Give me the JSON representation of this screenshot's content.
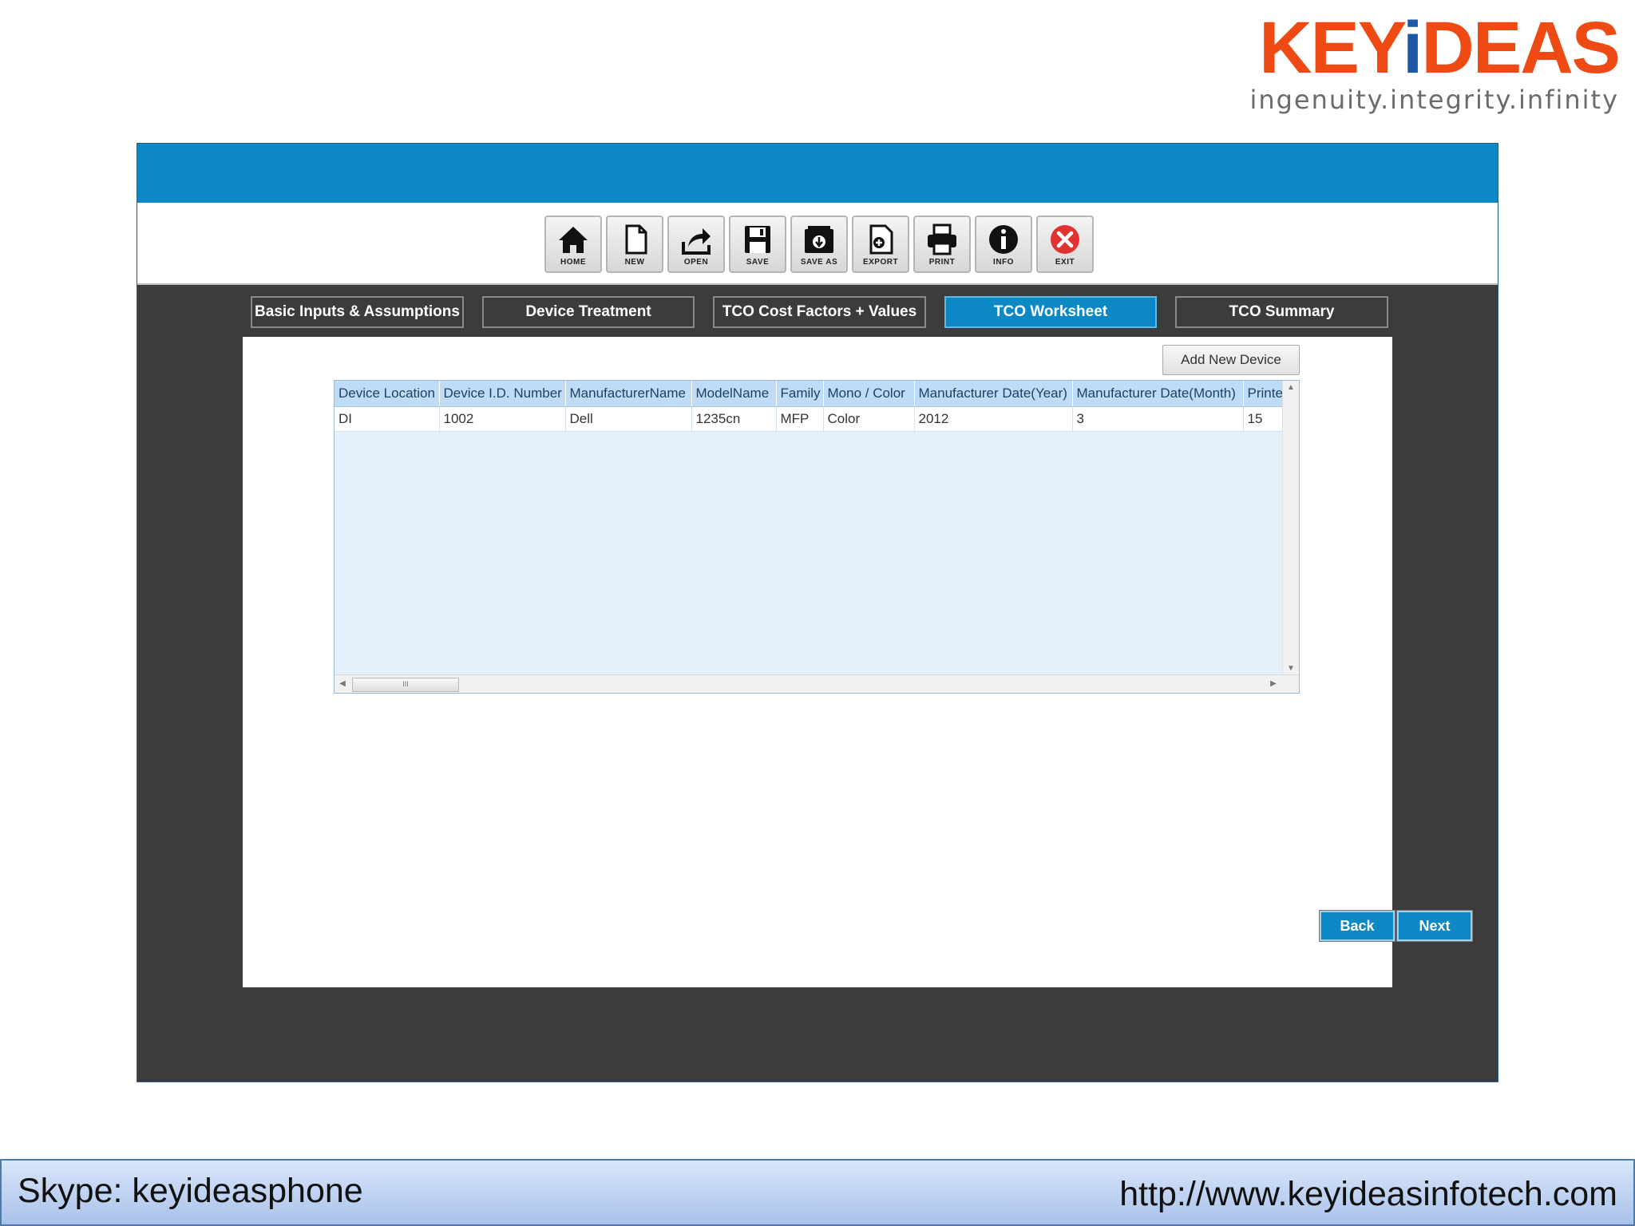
{
  "logo": {
    "word_part1": "KEY",
    "word_i": "i",
    "word_part2": "DEAS",
    "tagline": "ingenuity.integrity.infinity",
    "colors": {
      "word": "#f04a14",
      "i": "#1d58a8",
      "tagline": "#6b6b6b"
    }
  },
  "toolbar": {
    "buttons": [
      {
        "label": "HOME",
        "icon": "home-icon"
      },
      {
        "label": "NEW",
        "icon": "new-document-icon"
      },
      {
        "label": "OPEN",
        "icon": "open-share-icon"
      },
      {
        "label": "SAVE",
        "icon": "save-icon"
      },
      {
        "label": "SAVE AS",
        "icon": "save-as-icon"
      },
      {
        "label": "EXPORT",
        "icon": "export-icon"
      },
      {
        "label": "PRINT",
        "icon": "print-icon"
      },
      {
        "label": "INFO",
        "icon": "info-icon"
      },
      {
        "label": "EXIT",
        "icon": "exit-icon"
      }
    ]
  },
  "tabs": [
    {
      "label": "Basic Inputs & Assumptions",
      "active": false
    },
    {
      "label": "Device Treatment",
      "active": false
    },
    {
      "label": "TCO Cost Factors + Values",
      "active": false
    },
    {
      "label": "TCO Worksheet",
      "active": true
    },
    {
      "label": "TCO Summary",
      "active": false
    }
  ],
  "worksheet": {
    "add_button_label": "Add New Device",
    "columns": [
      "Device Location",
      "Device I.D. Number",
      "ManufacturerName",
      "ModelName",
      "Family",
      "Mono / Color",
      "Manufacturer Date(Year)",
      "Manufacturer Date(Month)",
      "Printe"
    ],
    "rows": [
      [
        "DI",
        "1002",
        "Dell",
        "1235cn",
        "MFP",
        "Color",
        "2012",
        "3",
        "15"
      ]
    ],
    "hscroll_thumb": "III"
  },
  "navigation": {
    "back_label": "Back",
    "next_label": "Next"
  },
  "footer": {
    "skype": "Skype: keyideasphone",
    "url": "http://www.keyideasinfotech.com"
  },
  "colors": {
    "accent": "#0c88c5",
    "app_background": "#3c3c3e",
    "grid_header": "#bfdcf6",
    "grid_body": "#e4f1fd",
    "exit_red": "#e23131"
  }
}
